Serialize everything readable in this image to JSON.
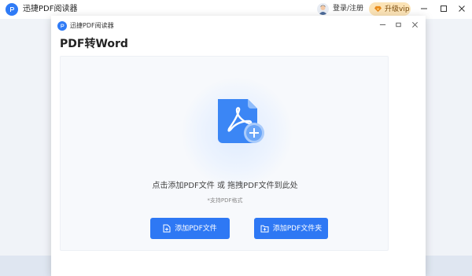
{
  "app": {
    "title": "迅捷PDF阅读器",
    "login": "登录/注册",
    "vip": "升级vip",
    "accent": "#2f7bf6",
    "vip_color": "#fbe3b6"
  },
  "dialog": {
    "title": "迅捷PDF阅读器",
    "heading": "PDF转Word",
    "drop_hint": "点击添加PDF文件 或 拖拽PDF文件到此处",
    "format_note": "*支持PDF格式",
    "add_file_label": "添加PDF文件",
    "add_folder_label": "添加PDF文件夹",
    "button_color": "#2e78f4"
  },
  "icons": {
    "app_logo": "app-logo-icon",
    "avatar": "avatar",
    "vip": "diamond-icon",
    "minimize": "minimize-icon",
    "maximize": "maximize-icon",
    "close": "close-icon",
    "pdf_file": "pdf-file-add-icon",
    "add_file": "file-add-icon",
    "add_folder": "folder-add-icon"
  }
}
